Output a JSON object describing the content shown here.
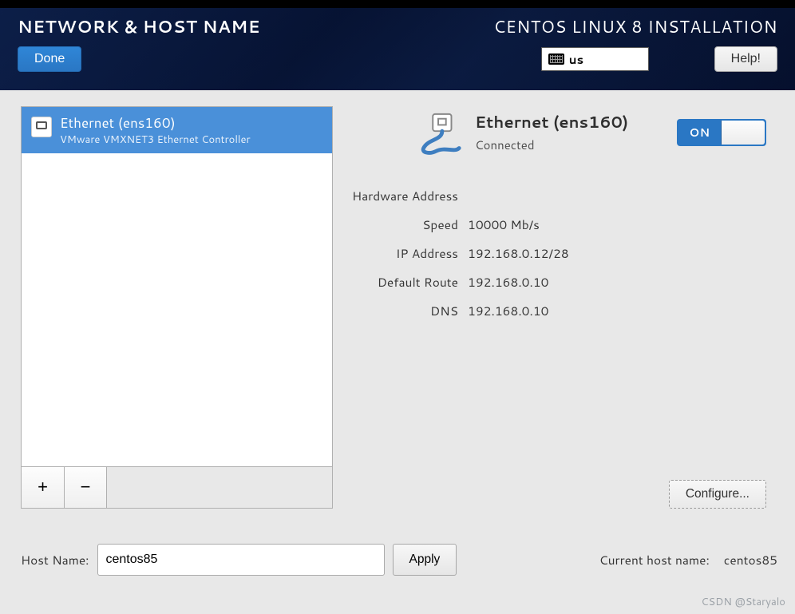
{
  "header": {
    "title": "NETWORK & HOST NAME",
    "done_label": "Done",
    "install_title": "CENTOS LINUX 8 INSTALLATION",
    "keyboard_layout": "us",
    "help_label": "Help!"
  },
  "network_list": {
    "items": [
      {
        "title": "Ethernet (ens160)",
        "subtitle": "VMware VMXNET3 Ethernet Controller"
      }
    ],
    "add_button": "+",
    "remove_button": "−"
  },
  "detail": {
    "title": "Ethernet (ens160)",
    "status": "Connected",
    "toggle_state": "ON",
    "rows": {
      "hardware_address": {
        "label": "Hardware Address",
        "value": ""
      },
      "speed": {
        "label": "Speed",
        "value": "10000 Mb/s"
      },
      "ip_address": {
        "label": "IP Address",
        "value": "192.168.0.12/28"
      },
      "default_route": {
        "label": "Default Route",
        "value": "192.168.0.10"
      },
      "dns": {
        "label": "DNS",
        "value": "192.168.0.10"
      }
    },
    "configure_label": "Configure..."
  },
  "hostname": {
    "label": "Host Name:",
    "value": "centos85",
    "apply_label": "Apply",
    "current_label": "Current host name:",
    "current_value": "centos85"
  },
  "footer": {
    "watermark": "CSDN @Staryalo"
  }
}
